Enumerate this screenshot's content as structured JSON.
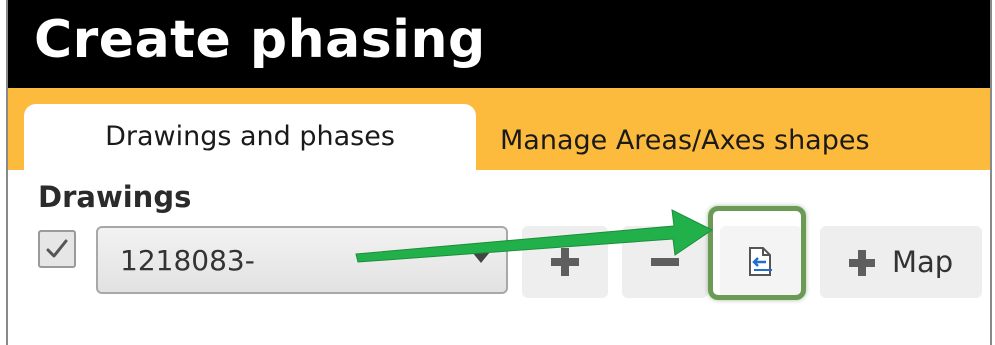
{
  "window": {
    "title": "Create phasing"
  },
  "tabs": [
    {
      "label": "Drawings and phases",
      "active": true
    },
    {
      "label": "Manage Areas/Axes shapes",
      "active": false
    }
  ],
  "drawings": {
    "section_label": "Drawings",
    "checkbox_checked": true,
    "selected_drawing": "1218083-",
    "toolbar": {
      "add_icon": "plus-icon",
      "remove_icon": "minus-icon",
      "export_icon": "document-arrow-icon",
      "map_label": "Map"
    }
  },
  "annotation": {
    "arrow_color": "#22b04a",
    "highlight_color": "#6b9a57"
  },
  "colors": {
    "titlebar": "#000000",
    "tabstrip": "#fdbb3d",
    "accent_blue": "#1e6fd0"
  }
}
